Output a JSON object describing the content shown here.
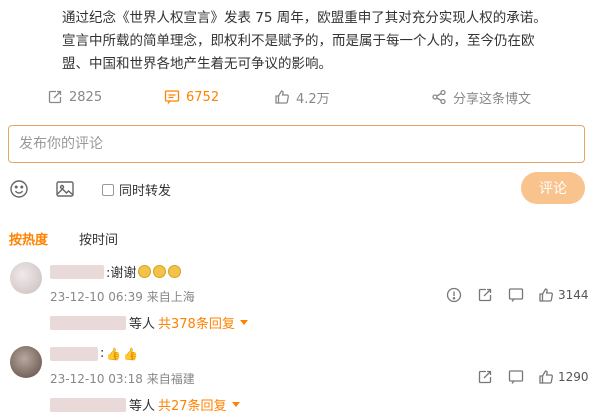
{
  "post": {
    "lines": [
      "通过纪念《世界人权宣言》发表 75 周年，欧盟重申了其对充分实现人权的承诺。",
      "宣言中所载的简单理念，即权利不是赋予的，而是属于每一个人的，至今仍在欧",
      "盟、中国和世界各地产生着无可争议的影响。"
    ]
  },
  "actions": {
    "repost_count": "2825",
    "comment_count": "6752",
    "like_count": "4.2万",
    "share_label": "分享这条博文"
  },
  "composer": {
    "placeholder": "发布你的评论",
    "repost_label": "同时转发",
    "submit_label": "评论"
  },
  "sort": {
    "hot_label": "按热度",
    "time_label": "按时间"
  },
  "comments": [
    {
      "text": ":谢谢",
      "time": "23-12-10 06:39",
      "location": "来自上海",
      "likes": "3144",
      "reply_prefix": "等人",
      "reply_link": "共378条回复"
    },
    {
      "text": ":",
      "time": "23-12-10 03:18",
      "location": "来自福建",
      "likes": "1290",
      "reply_prefix": "等人",
      "reply_link": "共27条回复"
    }
  ],
  "colors": {
    "accent": "#ff8200",
    "button_disabled": "#f9c38e",
    "input_border": "#e3a86a"
  }
}
